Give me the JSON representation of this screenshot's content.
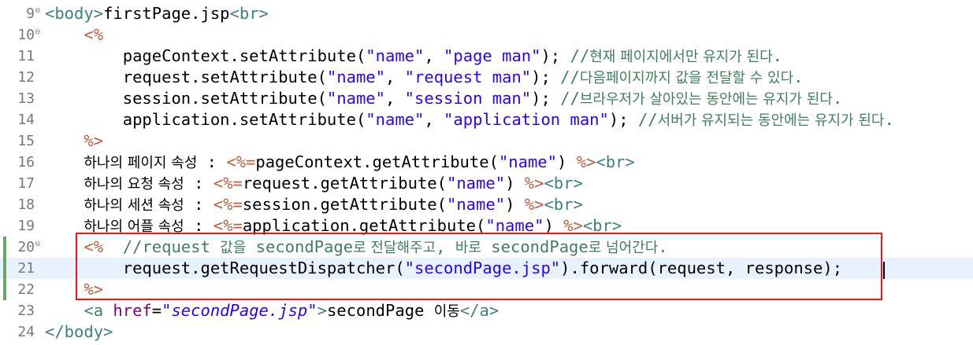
{
  "editor": {
    "file": "firstPage.jsp",
    "lines": [
      {
        "num": "9",
        "fold": "⊖",
        "parts": [
          {
            "t": "<body>",
            "c": "tag"
          },
          {
            "t": "firstPage.jsp",
            "c": ""
          },
          {
            "t": "<br>",
            "c": "tag"
          }
        ]
      },
      {
        "num": "10",
        "fold": "⊖",
        "parts": [
          {
            "t": "    ",
            "c": ""
          },
          {
            "t": "<%",
            "c": "dlm"
          }
        ]
      },
      {
        "num": "11",
        "fold": "",
        "parts": [
          {
            "t": "        pageContext.setAttribute(",
            "c": ""
          },
          {
            "t": "\"name\"",
            "c": "str"
          },
          {
            "t": ", ",
            "c": ""
          },
          {
            "t": "\"page man\"",
            "c": "str"
          },
          {
            "t": "); ",
            "c": ""
          },
          {
            "t": "//현재 페이지에서만 유지가 된다.",
            "c": "cmt"
          }
        ]
      },
      {
        "num": "12",
        "fold": "",
        "parts": [
          {
            "t": "        request.setAttribute(",
            "c": ""
          },
          {
            "t": "\"name\"",
            "c": "str"
          },
          {
            "t": ", ",
            "c": ""
          },
          {
            "t": "\"request man\"",
            "c": "str"
          },
          {
            "t": "); ",
            "c": ""
          },
          {
            "t": "//다음페이지까지 값을 전달할 수 있다.",
            "c": "cmt"
          }
        ]
      },
      {
        "num": "13",
        "fold": "",
        "parts": [
          {
            "t": "        session.setAttribute(",
            "c": ""
          },
          {
            "t": "\"name\"",
            "c": "str"
          },
          {
            "t": ", ",
            "c": ""
          },
          {
            "t": "\"session man\"",
            "c": "str"
          },
          {
            "t": "); ",
            "c": ""
          },
          {
            "t": "//브라우저가 살아있는 동안에는 유지가 된다.",
            "c": "cmt"
          }
        ]
      },
      {
        "num": "14",
        "fold": "",
        "parts": [
          {
            "t": "        application.setAttribute(",
            "c": ""
          },
          {
            "t": "\"name\"",
            "c": "str"
          },
          {
            "t": ", ",
            "c": ""
          },
          {
            "t": "\"application man\"",
            "c": "str"
          },
          {
            "t": "); ",
            "c": ""
          },
          {
            "t": "//서버가 유지되는 동안에는 유지가 된다.",
            "c": "cmt"
          }
        ]
      },
      {
        "num": "15",
        "fold": "",
        "parts": [
          {
            "t": "    ",
            "c": ""
          },
          {
            "t": "%>",
            "c": "dlm"
          }
        ]
      },
      {
        "num": "16",
        "fold": "",
        "parts": [
          {
            "t": "    하나의 페이지 속성 : ",
            "c": ""
          },
          {
            "t": "<%=",
            "c": "dlm"
          },
          {
            "t": "pageContext.getAttribute(",
            "c": ""
          },
          {
            "t": "\"name\"",
            "c": "str"
          },
          {
            "t": ") ",
            "c": ""
          },
          {
            "t": "%>",
            "c": "dlm"
          },
          {
            "t": "<br>",
            "c": "tag"
          }
        ]
      },
      {
        "num": "17",
        "fold": "",
        "parts": [
          {
            "t": "    하나의 요청 속성 : ",
            "c": ""
          },
          {
            "t": "<%=",
            "c": "dlm"
          },
          {
            "t": "request.getAttribute(",
            "c": ""
          },
          {
            "t": "\"name\"",
            "c": "str"
          },
          {
            "t": ") ",
            "c": ""
          },
          {
            "t": "%>",
            "c": "dlm"
          },
          {
            "t": "<br>",
            "c": "tag"
          }
        ]
      },
      {
        "num": "18",
        "fold": "",
        "parts": [
          {
            "t": "    하나의 세션 속성 : ",
            "c": ""
          },
          {
            "t": "<%=",
            "c": "dlm"
          },
          {
            "t": "session.getAttribute(",
            "c": ""
          },
          {
            "t": "\"name\"",
            "c": "str"
          },
          {
            "t": ") ",
            "c": ""
          },
          {
            "t": "%>",
            "c": "dlm"
          },
          {
            "t": "<br>",
            "c": "tag"
          }
        ]
      },
      {
        "num": "19",
        "fold": "",
        "parts": [
          {
            "t": "    하나의 어플 속성 : ",
            "c": ""
          },
          {
            "t": "<%=",
            "c": "dlm"
          },
          {
            "t": "application.getAttribute(",
            "c": ""
          },
          {
            "t": "\"name\"",
            "c": "str"
          },
          {
            "t": ") ",
            "c": ""
          },
          {
            "t": "%>",
            "c": "dlm"
          },
          {
            "t": "<br>",
            "c": "tag"
          }
        ]
      },
      {
        "num": "20",
        "fold": "⊖",
        "parts": [
          {
            "t": "    ",
            "c": ""
          },
          {
            "t": "<%",
            "c": "dlm"
          },
          {
            "t": "  ",
            "c": ""
          },
          {
            "t": "//request 값을 secondPage로 전달해주고, 바로 secondPage로 넘어간다.",
            "c": "cmt"
          }
        ]
      },
      {
        "num": "21",
        "fold": "",
        "parts": [
          {
            "t": "        request.getRequestDispatcher(",
            "c": ""
          },
          {
            "t": "\"secondPage.jsp\"",
            "c": "str"
          },
          {
            "t": ").forward(request, response);",
            "c": ""
          }
        ]
      },
      {
        "num": "22",
        "fold": "",
        "parts": [
          {
            "t": "    ",
            "c": ""
          },
          {
            "t": "%>",
            "c": "dlm"
          }
        ]
      },
      {
        "num": "23",
        "fold": "",
        "parts": [
          {
            "t": "    ",
            "c": ""
          },
          {
            "t": "<a ",
            "c": "tag"
          },
          {
            "t": "href",
            "c": "attr"
          },
          {
            "t": "=",
            "c": ""
          },
          {
            "t": "\"secondPage.jsp\"",
            "c": "attrval"
          },
          {
            "t": ">",
            "c": "tag"
          },
          {
            "t": "secondPage 이동",
            "c": ""
          },
          {
            "t": "</a>",
            "c": "tag"
          }
        ]
      },
      {
        "num": "24",
        "fold": "",
        "parts": [
          {
            "t": "</body>",
            "c": "tag"
          }
        ]
      }
    ]
  }
}
